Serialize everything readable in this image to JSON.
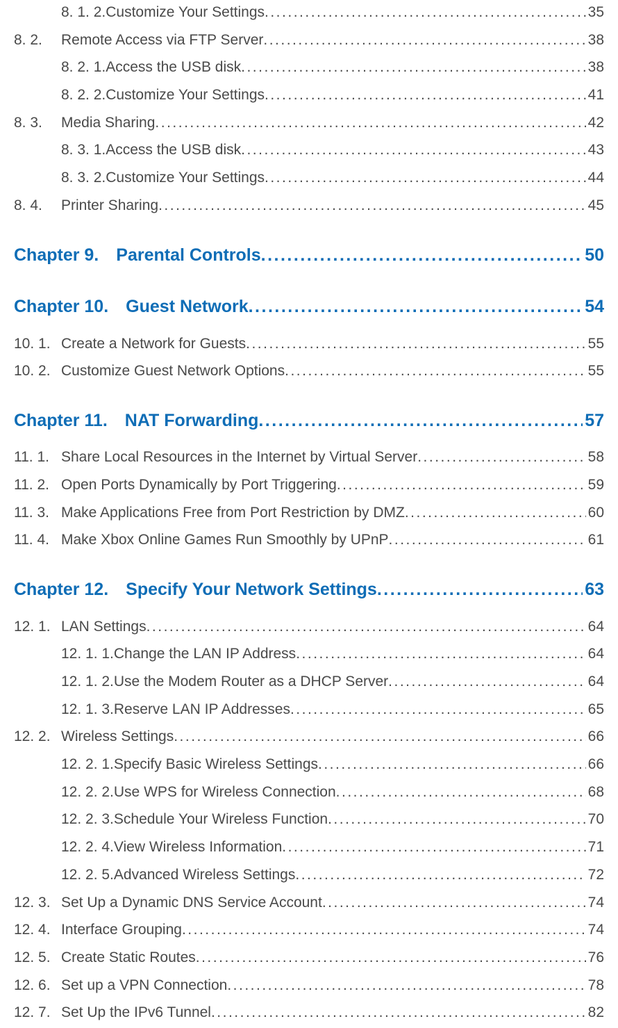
{
  "dots": "................................................................................................................................................................................",
  "entries": [
    {
      "level": "subsection",
      "num": "8. 1. 2.",
      "title": "Customize Your Settings",
      "page": "35"
    },
    {
      "level": "section",
      "num": "8. 2.",
      "title": "Remote Access via FTP Server",
      "page": "38"
    },
    {
      "level": "subsection",
      "num": "8. 2. 1.",
      "title": "Access the USB disk",
      "page": "38"
    },
    {
      "level": "subsection",
      "num": "8. 2. 2.",
      "title": "Customize Your Settings",
      "page": "41"
    },
    {
      "level": "section",
      "num": "8. 3.",
      "title": "Media Sharing",
      "page": "42"
    },
    {
      "level": "subsection",
      "num": "8. 3. 1.",
      "title": "Access the USB disk",
      "page": "43"
    },
    {
      "level": "subsection",
      "num": "8. 3. 2.",
      "title": "Customize Your Settings",
      "page": "44"
    },
    {
      "level": "section",
      "num": "8. 4.",
      "title": "Printer Sharing",
      "page": "45"
    },
    {
      "level": "chapter",
      "num": "Chapter 9.",
      "title": "Parental Controls",
      "page": "50"
    },
    {
      "level": "chapter",
      "num": "Chapter 10.",
      "title": "Guest Network",
      "page": "54"
    },
    {
      "level": "section",
      "num": "10. 1.",
      "title": "Create a Network for Guests",
      "page": "55"
    },
    {
      "level": "section",
      "num": "10. 2.",
      "title": "Customize Guest Network Options",
      "page": "55"
    },
    {
      "level": "chapter",
      "num": "Chapter 11.",
      "title": "NAT Forwarding",
      "page": "57"
    },
    {
      "level": "section",
      "num": "11. 1.",
      "title": "Share Local Resources in the Internet by Virtual Server",
      "page": "58"
    },
    {
      "level": "section",
      "num": "11. 2.",
      "title": "Open Ports Dynamically by Port Triggering",
      "page": "59"
    },
    {
      "level": "section",
      "num": "11. 3.",
      "title": "Make Applications Free from Port Restriction by DMZ",
      "page": "60"
    },
    {
      "level": "section",
      "num": "11. 4.",
      "title": "Make Xbox Online Games Run Smoothly by UPnP",
      "page": "61"
    },
    {
      "level": "chapter",
      "num": "Chapter 12.",
      "title": "Specify Your Network Settings",
      "page": "63"
    },
    {
      "level": "section",
      "num": "12. 1.",
      "title": "LAN Settings",
      "page": "64"
    },
    {
      "level": "subsection",
      "num": "12. 1. 1.",
      "title": "Change the LAN IP Address",
      "page": "64"
    },
    {
      "level": "subsection",
      "num": "12. 1. 2.",
      "title": "Use the Modem Router as a DHCP Server",
      "page": "64"
    },
    {
      "level": "subsection",
      "num": "12. 1. 3.",
      "title": "Reserve LAN IP Addresses",
      "page": "65"
    },
    {
      "level": "section",
      "num": "12. 2.",
      "title": "Wireless Settings",
      "page": "66"
    },
    {
      "level": "subsection",
      "num": "12. 2. 1.",
      "title": "Specify Basic Wireless Settings",
      "page": "66"
    },
    {
      "level": "subsection",
      "num": "12. 2. 2.",
      "title": "Use WPS for Wireless Connection",
      "page": "68"
    },
    {
      "level": "subsection",
      "num": "12. 2. 3.",
      "title": "Schedule Your Wireless Function",
      "page": "70"
    },
    {
      "level": "subsection",
      "num": "12. 2. 4.",
      "title": "View Wireless Information",
      "page": "71"
    },
    {
      "level": "subsection",
      "num": "12. 2. 5.",
      "title": "Advanced Wireless Settings",
      "page": "72"
    },
    {
      "level": "section",
      "num": "12. 3.",
      "title": "Set Up a Dynamic DNS Service Account",
      "page": "74"
    },
    {
      "level": "section",
      "num": "12. 4.",
      "title": "Interface Grouping",
      "page": "74"
    },
    {
      "level": "section",
      "num": "12. 5.",
      "title": "Create Static Routes",
      "page": "76"
    },
    {
      "level": "section",
      "num": "12. 6.",
      "title": "Set up a VPN Connection",
      "page": "78"
    },
    {
      "level": "section",
      "num": "12. 7.",
      "title": "Set Up the IPv6 Tunnel",
      "page": "82"
    }
  ]
}
